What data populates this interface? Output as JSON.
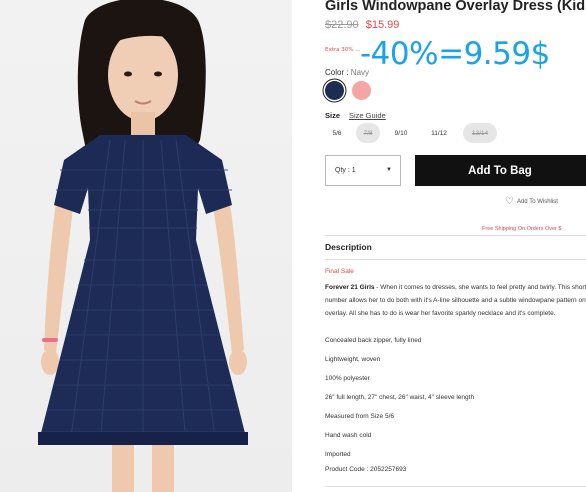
{
  "product": {
    "title": "Girls Windowpane Overlay Dress (Kids)",
    "price_original": "$22.90",
    "price_sale": "$15.99",
    "promo_text": "Extra 30% ...",
    "overlay_annotation": "-40%=9.59$"
  },
  "color": {
    "label": "Color :",
    "selected": "Navy",
    "swatches": [
      {
        "name": "Navy",
        "hex": "#1d2c52",
        "selected": true
      },
      {
        "name": "Pink",
        "hex": "#f3a6a3",
        "selected": false
      }
    ]
  },
  "size": {
    "label": "Size",
    "guide_link": "Size Guide",
    "options": [
      {
        "label": "5/6",
        "available": true
      },
      {
        "label": "7/8",
        "available": false
      },
      {
        "label": "9/10",
        "available": true
      },
      {
        "label": "11/12",
        "available": true
      },
      {
        "label": "13/14",
        "available": false
      }
    ]
  },
  "quantity": {
    "label": "Qty : 1"
  },
  "actions": {
    "add_to_bag": "Add To Bag",
    "wishlist": "Add To Wishlist"
  },
  "shipping_note": "Free Shipping On Orders Over $",
  "description": {
    "heading": "Description",
    "final_sale": "Final Sale",
    "brand": "Forever 21 Girls",
    "body": " - When it comes to dresses, she wants to feel pretty and twirly. This short-sleeved number allows her to do both with it's A-line silhouette and a subtle windowpane pattern on its sheer overlay. All she has to do is wear her favorite sparkly necklace and it's complete.",
    "details": [
      "Concealed back zipper, fully lined",
      "Lightweight, woven",
      "100% polyester",
      "26\" full length, 27\" chest, 26\" waist, 4\" sleeve length",
      "Measured from Size 5/6",
      "Hand wash cold",
      "Imported",
      "Product Code : 2052257693"
    ]
  },
  "colors": {
    "sale_red": "#e3494a",
    "overlay_blue": "#1aa3e8",
    "button_black": "#111111"
  }
}
